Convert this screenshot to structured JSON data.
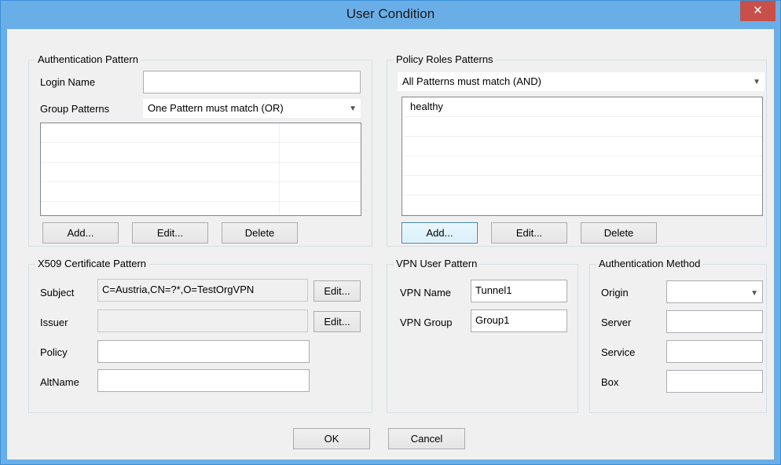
{
  "window": {
    "title": "User Condition",
    "close_glyph": "✕"
  },
  "auth_pattern": {
    "title": "Authentication Pattern",
    "login_name_label": "Login Name",
    "login_name_value": "",
    "group_patterns_label": "Group Patterns",
    "group_patterns_value": "One Pattern must match (OR)",
    "rows": [
      "",
      "",
      "",
      ""
    ],
    "buttons": {
      "add": "Add...",
      "edit": "Edit...",
      "delete": "Delete"
    }
  },
  "policy_roles": {
    "title": "Policy Roles Patterns",
    "match_value": "All Patterns must match (AND)",
    "rows": [
      "healthy",
      "",
      "",
      "",
      "",
      ""
    ],
    "buttons": {
      "add": "Add...",
      "edit": "Edit...",
      "delete": "Delete"
    }
  },
  "x509": {
    "title": "X509 Certificate Pattern",
    "subject_label": "Subject",
    "subject_value": "C=Austria,CN=?*,O=TestOrgVPN",
    "issuer_label": "Issuer",
    "issuer_value": "",
    "policy_label": "Policy",
    "policy_value": "",
    "altname_label": "AltName",
    "altname_value": "",
    "edit_label": "Edit..."
  },
  "vpn_user": {
    "title": "VPN User Pattern",
    "vpn_name_label": "VPN Name",
    "vpn_name_value": "Tunnel1",
    "vpn_group_label": "VPN Group",
    "vpn_group_value": "Group1"
  },
  "auth_method": {
    "title": "Authentication Method",
    "origin_label": "Origin",
    "origin_value": "",
    "server_label": "Server",
    "server_value": "",
    "service_label": "Service",
    "service_value": "",
    "box_label": "Box",
    "box_value": ""
  },
  "footer": {
    "ok": "OK",
    "cancel": "Cancel"
  },
  "colors": {
    "titlebar": "#6aaee8",
    "close": "#c7504a",
    "dialog_bg": "#f0f0f0"
  },
  "icons": {
    "close": "close-icon",
    "dropdown": "chevron-down-icon"
  }
}
